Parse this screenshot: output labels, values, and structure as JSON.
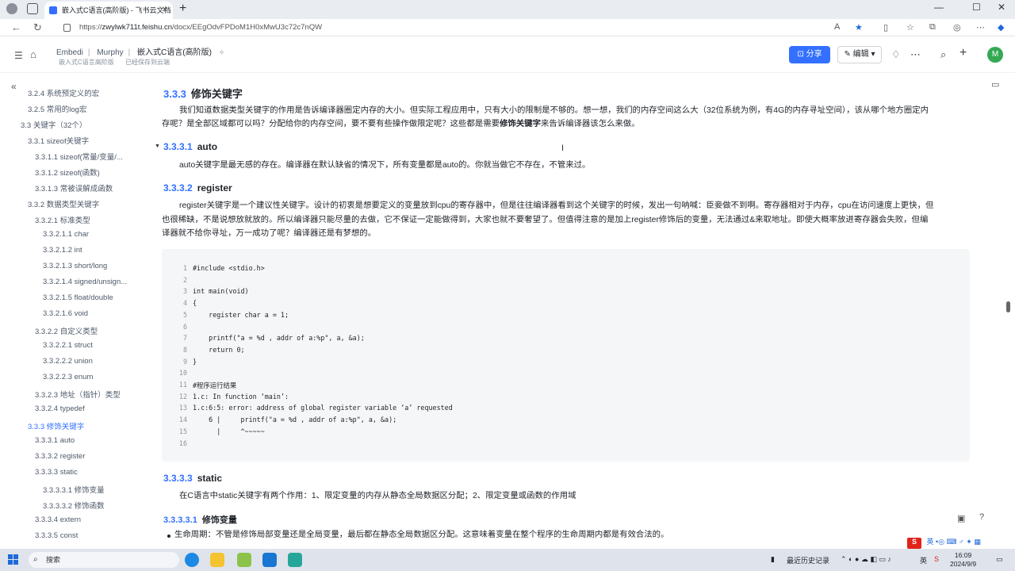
{
  "browser": {
    "tab_title": "嵌入式C语言(高阶版) - 飞书云文档",
    "url_prefix": "https://",
    "url_host": "zwylwk711t.feishu.cn",
    "url_path": "/docx/EEgOdvFPDoM1H0xMwU3c72c7nQW"
  },
  "header": {
    "breadcrumbs": [
      "Embedi",
      "Murphy",
      "嵌入式C语言(高阶版)"
    ],
    "sub_left": "嵌入式C语言高阶版",
    "sub_right": "已经保存到云端",
    "share_label": "分享",
    "edit_label": "编辑",
    "avatar_letter": "M",
    "accent": "#3370ff"
  },
  "sidebar": {
    "items": [
      {
        "label": "3.2.4 系统预定义的宏",
        "indent": 2
      },
      {
        "label": "3.2.5 常用的log宏",
        "indent": 2
      },
      {
        "label": "3.3 关键字（32个）",
        "indent": 1
      },
      {
        "label": "3.3.1 sizeof关键字",
        "indent": 2
      },
      {
        "label": "3.3.1.1 sizeof(常量/变量/...",
        "indent": 3
      },
      {
        "label": "3.3.1.2 sizeof(函数)",
        "indent": 3
      },
      {
        "label": "3.3.1.3 常被误解成函数",
        "indent": 3
      },
      {
        "label": "3.3.2 数据类型关键字",
        "indent": 2
      },
      {
        "label": "3.3.2.1 标准类型",
        "indent": 3
      },
      {
        "label": "3.3.2.1.1 char",
        "indent": 4
      },
      {
        "label": "3.3.2.1.2 int",
        "indent": 4
      },
      {
        "label": "3.3.2.1.3 short/long",
        "indent": 4
      },
      {
        "label": "3.3.2.1.4 signed/unsign...",
        "indent": 4
      },
      {
        "label": "3.3.2.1.5 float/double",
        "indent": 4
      },
      {
        "label": "3.3.2.1.6 void",
        "indent": 4
      },
      {
        "label": "3.3.2.2 自定义类型",
        "indent": 3
      },
      {
        "label": "3.3.2.2.1 struct",
        "indent": 4
      },
      {
        "label": "3.3.2.2.2 union",
        "indent": 4
      },
      {
        "label": "3.3.2.2.3 enum",
        "indent": 4
      },
      {
        "label": "3.3.2.3 地址（指针）类型",
        "indent": 3
      },
      {
        "label": "3.3.2.4 typedef",
        "indent": 3
      },
      {
        "label": "3.3.3 修饰关键字",
        "indent": 2,
        "active": true
      },
      {
        "label": "3.3.3.1 auto",
        "indent": 3
      },
      {
        "label": "3.3.3.2 register",
        "indent": 3
      },
      {
        "label": "3.3.3.3 static",
        "indent": 3
      },
      {
        "label": "3.3.3.3.1 修饰变量",
        "indent": 4
      },
      {
        "label": "3.3.3.3.2 修饰函数",
        "indent": 4
      },
      {
        "label": "3.3.3.4 extern",
        "indent": 3
      },
      {
        "label": "3.3.3.5 const",
        "indent": 3
      }
    ]
  },
  "content": {
    "h333": {
      "num": "3.3.3",
      "title": "修饰关键字"
    },
    "p333a": "我们知道数据类型关键字的作用是告诉编译器圈定内存的大小。但实际工程应用中，只有大小的限制是不够的。想一想，我们的内存空间这么大（32位系统为例，有4G的内存寻址空间），该从哪个地方圈定内",
    "p333b_pre": "存呢？是全部区域都可以吗？分配给你的内存空间，要不要有些操作做限定呢？这些都是需要",
    "p333b_bold": "修饰关键字",
    "p333b_post": "来告诉编译器该怎么来做。",
    "h3331": {
      "num": "3.3.3.1",
      "title": "auto"
    },
    "p3331": "auto关键字是最无感的存在。编译器在默认缺省的情况下，所有变量都是auto的。你就当做它不存在，不管来过。",
    "h3332": {
      "num": "3.3.3.2",
      "title": "register"
    },
    "p3332a": "register关键字是一个建议性关键字。设计的初衷是想要定义的变量放到cpu的寄存器中，但是往往编译器看到这个关键字的时候，发出一句呐喊：臣妾做不到啊。寄存器相对于内存，cpu在访问速度上更快，但",
    "p3332b": "也很稀缺，不是说想放就放的。所以编译器只能尽量的去做，它不保证一定能做得到，大家也就不要奢望了。但值得注意的是加上register修饰后的变量，无法通过&来取地址。即使大概率放进寄存器会失败，但编",
    "p3332c": "译器就不给你寻址，万一成功了呢？编译器还是有梦想的。",
    "code": [
      {
        "n": "1",
        "t": "#include <stdio.h>"
      },
      {
        "n": "2",
        "t": ""
      },
      {
        "n": "3",
        "t": "int main(void)"
      },
      {
        "n": "4",
        "t": "{"
      },
      {
        "n": "5",
        "t": "    register char a = 1;"
      },
      {
        "n": "6",
        "t": ""
      },
      {
        "n": "7",
        "t": "    printf(\"a = %d , addr of a:%p\", a, &a);"
      },
      {
        "n": "8",
        "t": "    return 0;"
      },
      {
        "n": "9",
        "t": "}"
      },
      {
        "n": "10",
        "t": ""
      },
      {
        "n": "11",
        "t": "#程序运行结果"
      },
      {
        "n": "12",
        "t": "1.c: In function ‘main’:"
      },
      {
        "n": "13",
        "t": "1.c:6:5: error: address of global register variable ‘a’ requested"
      },
      {
        "n": "14",
        "t": "    6 |     printf(\"a = %d , addr of a:%p\", a, &a);"
      },
      {
        "n": "15",
        "t": "      |     ^~~~~~"
      },
      {
        "n": "16",
        "t": ""
      }
    ],
    "h3333": {
      "num": "3.3.3.3",
      "title": "static"
    },
    "p3333": "在C语言中static关键字有两个作用：1、限定变量的内存从静态全局数据区分配；2、限定变量或函数的作用域",
    "h33331": {
      "num": "3.3.3.3.1",
      "title": "修饰变量"
    },
    "bullet1": "生命周期：不管是修饰局部变量还是全局变量，最后都在静态全局数据区分配。这意味着变量在整个程序的生命周期内都是有效合法的。",
    "heading_marker": "H4"
  },
  "taskbar": {
    "search_label": "搜索",
    "history_label": "最近历史记录",
    "lang_label": "英",
    "time": "16:09",
    "date": "2024/9/9"
  },
  "ime_label": "英"
}
